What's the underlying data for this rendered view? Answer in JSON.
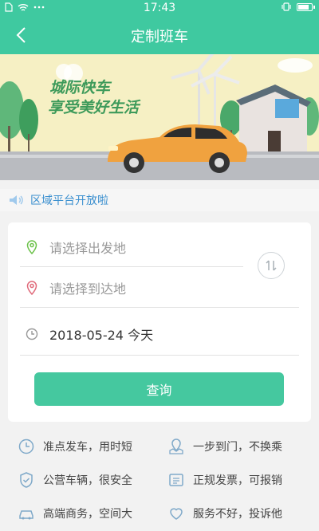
{
  "status_bar": {
    "time": "17:43",
    "battery_level": 0.85
  },
  "nav": {
    "title": "定制班车"
  },
  "banner": {
    "line1": "城际快车",
    "line2": "享受美好生活"
  },
  "notice": {
    "text": "区域平台开放啦"
  },
  "form": {
    "departure_placeholder": "请选择出发地",
    "destination_placeholder": "请选择到达地",
    "date_value": "2018-05-24 今天",
    "search_label": "查询"
  },
  "features": [
    {
      "icon": "clock-icon",
      "text": "准点发车，用时短"
    },
    {
      "icon": "map-pin-icon",
      "text": "一步到门，不换乘"
    },
    {
      "icon": "shield-check-icon",
      "text": "公营车辆，很安全"
    },
    {
      "icon": "invoice-icon",
      "text": "正规发票，可报销"
    },
    {
      "icon": "car-icon",
      "text": "高端商务，空间大"
    },
    {
      "icon": "heart-icon",
      "text": "服务不好，投诉他"
    }
  ],
  "colors": {
    "primary": "#3fc9a0",
    "button": "#45c89f",
    "notice_text": "#3a8fcf"
  }
}
